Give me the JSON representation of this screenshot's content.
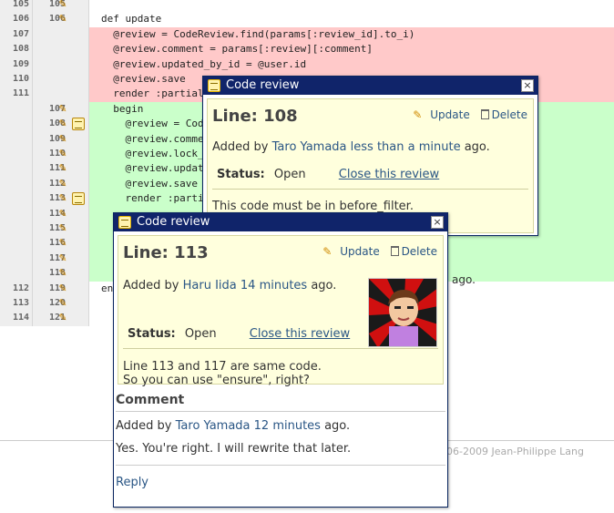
{
  "diff_rows": [
    {
      "ln1": "105",
      "ln2": "105",
      "type": "ctx",
      "code": "",
      "pencil": true,
      "review": false
    },
    {
      "ln1": "106",
      "ln2": "106",
      "type": "ctx",
      "code": "def update",
      "pencil": true,
      "review": false
    },
    {
      "ln1": "107",
      "ln2": "",
      "type": "del",
      "code": "  @review = CodeReview.find(params[:review_id].to_i)",
      "pencil": false,
      "review": false
    },
    {
      "ln1": "108",
      "ln2": "",
      "type": "del",
      "code": "  @review.comment = params[:review][:comment]",
      "pencil": false,
      "review": false
    },
    {
      "ln1": "109",
      "ln2": "",
      "type": "del",
      "code": "  @review.updated_by_id = @user.id",
      "pencil": false,
      "review": false
    },
    {
      "ln1": "110",
      "ln2": "",
      "type": "del",
      "code": "  @review.save",
      "pencil": false,
      "review": false
    },
    {
      "ln1": "111",
      "ln2": "",
      "type": "del",
      "code": "  render :partial =",
      "pencil": false,
      "review": false
    },
    {
      "ln1": "",
      "ln2": "107",
      "type": "add",
      "code": "  begin",
      "pencil": true,
      "review": false
    },
    {
      "ln1": "",
      "ln2": "108",
      "type": "add",
      "code": "    @review = CodeR",
      "pencil": true,
      "review": true
    },
    {
      "ln1": "",
      "ln2": "109",
      "type": "add",
      "code": "    @review.comment",
      "pencil": true,
      "review": false
    },
    {
      "ln1": "",
      "ln2": "110",
      "type": "add",
      "code": "    @review.lock_ve",
      "pencil": true,
      "review": false
    },
    {
      "ln1": "",
      "ln2": "111",
      "type": "add",
      "code": "    @review.updated",
      "pencil": true,
      "review": false
    },
    {
      "ln1": "",
      "ln2": "112",
      "type": "add",
      "code": "    @review.save",
      "pencil": true,
      "review": false
    },
    {
      "ln1": "",
      "ln2": "113",
      "type": "add",
      "code": "    render :partia",
      "pencil": true,
      "review": true
    },
    {
      "ln1": "",
      "ln2": "114",
      "type": "add",
      "code": "",
      "pencil": true,
      "review": false
    },
    {
      "ln1": "",
      "ln2": "115",
      "type": "add",
      "code": "",
      "pencil": true,
      "review": false
    },
    {
      "ln1": "",
      "ln2": "116",
      "type": "add",
      "code": "",
      "pencil": true,
      "review": false
    },
    {
      "ln1": "",
      "ln2": "117",
      "type": "add",
      "code": "",
      "pencil": true,
      "review": false
    },
    {
      "ln1": "",
      "ln2": "118",
      "type": "add",
      "code": "",
      "pencil": true,
      "review": false
    },
    {
      "ln1": "112",
      "ln2": "119",
      "type": "ctx",
      "code": "en",
      "pencil": true,
      "review": false
    },
    {
      "ln1": "113",
      "ln2": "120",
      "type": "ctx",
      "code": "",
      "pencil": true,
      "review": false
    },
    {
      "ln1": "114",
      "ln2": "121",
      "type": "ctx",
      "code": "",
      "pencil": true,
      "review": false
    }
  ],
  "outside": {
    "ago": "ago.",
    "footer": "06-2009 Jean-Philippe Lang"
  },
  "popup1": {
    "title": "Code review",
    "close": "×",
    "line_heading": "Line: 108",
    "update": "Update",
    "delete": "Delete",
    "added_by": "Added by",
    "author": "Taro Yamada",
    "time": "less than a minute",
    "ago": "ago.",
    "status_label": "Status:",
    "status_value": "Open",
    "close_review": "Close this review",
    "body": "This code must be in before_filter."
  },
  "popup2": {
    "title": "Code review",
    "close": "×",
    "line_heading": "Line: 113",
    "update": "Update",
    "delete": "Delete",
    "added_by": "Added by",
    "author": "Haru Iida",
    "time": "14 minutes",
    "ago": "ago.",
    "status_label": "Status:",
    "status_value": "Open",
    "close_review": "Close this review",
    "body_line1": "Line 113 and 117 are same code.",
    "body_line2": "So you can use \"ensure\", right?",
    "comment_heading": "Comment",
    "comment_added_by": "Added by",
    "comment_author": "Taro Yamada",
    "comment_time": "12 minutes",
    "comment_ago": "ago.",
    "comment_body": "Yes. You're right. I will rewrite that later.",
    "reply": "Reply"
  }
}
